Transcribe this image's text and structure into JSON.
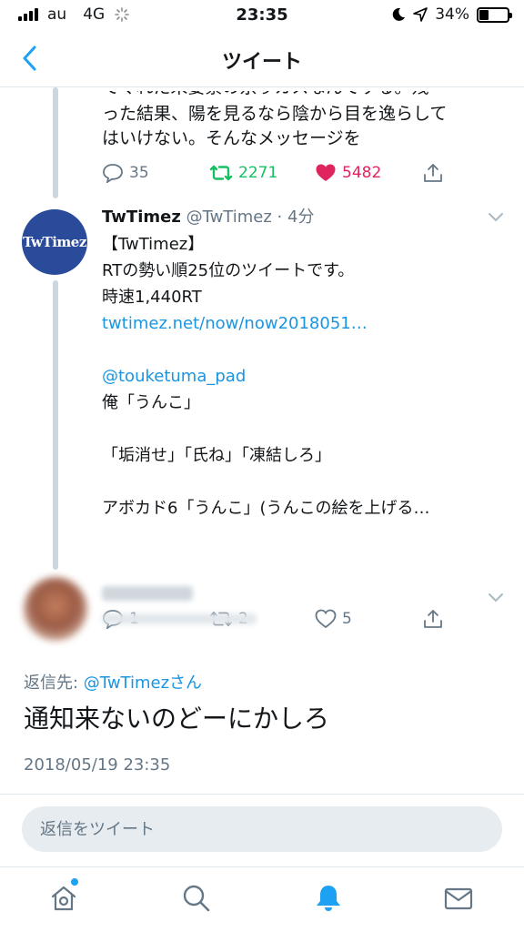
{
  "status_bar": {
    "carrier": "au",
    "network": "4G",
    "time": "23:35",
    "battery": "34%",
    "battery_level": 0.34
  },
  "header": {
    "title": "ツイート"
  },
  "prev_tweet": {
    "cut_line": "てくれた未要素の糸りカスなんでする。残",
    "lines": [
      "った結果、陽を見るなら陰から目を逸らして",
      "はいけない。そんなメッセージを"
    ],
    "replies": "35",
    "retweets": "2271",
    "likes": "5482"
  },
  "tweet2": {
    "avatar_text": "TwTimez",
    "name": "TwTimez",
    "handle": "@TwTimez",
    "time": "· 4分",
    "lines": [
      "【TwTimez】",
      "RTの勢い順25位のツイートです。",
      "時速1,440RT"
    ],
    "link": "twtimez.net/now/now2018051…",
    "mention": "@touketuma_pad",
    "lines2": [
      "俺「うんこ」"
    ],
    "lines3": [
      "「垢消せ」「氏ね」「凍結しろ」"
    ],
    "lines4": [
      "アボカド6「うんこ」(うんこの絵を上げる…"
    ],
    "replies": "1",
    "retweets": "2",
    "likes": "5"
  },
  "main_tweet": {
    "reply_prefix": "返信先: ",
    "reply_handle": "@TwTimez",
    "reply_suffix": "さん",
    "text": "通知来ないのどーにかしろ",
    "timestamp": "2018/05/19 23:35"
  },
  "reply_bar": {
    "placeholder": "返信をツイート"
  },
  "tabs": {
    "active": "notifications",
    "accent": "#1da1f2"
  },
  "colors": {
    "retweet_green": "#17bf63",
    "like_red": "#e0245e",
    "link_blue": "#1b95e0"
  }
}
